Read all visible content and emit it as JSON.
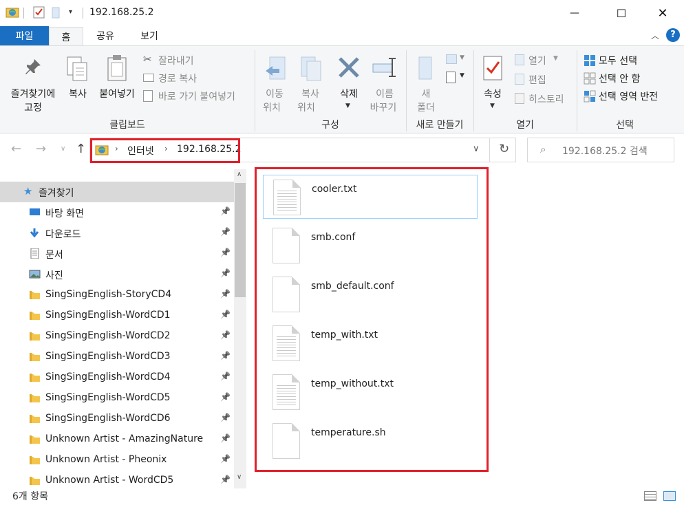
{
  "window": {
    "title": "192.168.25.2",
    "minimize_glyph": "—",
    "maximize_glyph": "☐",
    "close_glyph": "✕"
  },
  "tabs": [
    {
      "label": "파일",
      "active": false
    },
    {
      "label": "홈",
      "active": true
    },
    {
      "label": "공유",
      "active": false
    },
    {
      "label": "보기",
      "active": false
    }
  ],
  "ribbon": {
    "clipboard": {
      "pin_label_1": "즐겨찾기에",
      "pin_label_2": "고정",
      "copy_label": "복사",
      "paste_label": "붙여넣기",
      "cut_label": "잘라내기",
      "copy_path_label": "경로 복사",
      "paste_shortcut_label": "바로 가기 붙여넣기",
      "group_label": "클립보드"
    },
    "organize": {
      "move_label_1": "이동",
      "move_label_2": "위치",
      "copy_to_label_1": "복사",
      "copy_to_label_2": "위치",
      "delete_label": "삭제",
      "rename_label_1": "이름",
      "rename_label_2": "바꾸기",
      "group_label": "구성"
    },
    "new": {
      "new_folder_label_1": "새",
      "new_folder_label_2": "폴더",
      "group_label": "새로 만들기"
    },
    "open": {
      "properties_label": "속성",
      "open_label": "열기",
      "edit_label": "편집",
      "history_label": "히스토리",
      "group_label": "열기"
    },
    "select": {
      "select_all_label": "모두 선택",
      "select_none_label": "선택 안 함",
      "invert_label": "선택 영역 반전",
      "group_label": "선택"
    }
  },
  "address": {
    "crumbs": [
      "인터넷",
      "192.168.25.2"
    ],
    "search_placeholder": "192.168.25.2 검색"
  },
  "nav": {
    "favorites_label": "즐겨찾기",
    "items": [
      {
        "label": "바탕 화면",
        "icon": "desktop-icon"
      },
      {
        "label": "다운로드",
        "icon": "download-icon"
      },
      {
        "label": "문서",
        "icon": "documents-icon"
      },
      {
        "label": "사진",
        "icon": "pictures-icon"
      },
      {
        "label": "SingSingEnglish-StoryCD4",
        "icon": "folder-icon"
      },
      {
        "label": "SingSingEnglish-WordCD1",
        "icon": "folder-icon"
      },
      {
        "label": "SingSingEnglish-WordCD2",
        "icon": "folder-icon"
      },
      {
        "label": "SingSingEnglish-WordCD3",
        "icon": "folder-icon"
      },
      {
        "label": "SingSingEnglish-WordCD4",
        "icon": "folder-icon"
      },
      {
        "label": "SingSingEnglish-WordCD5",
        "icon": "folder-icon"
      },
      {
        "label": "SingSingEnglish-WordCD6",
        "icon": "folder-icon"
      },
      {
        "label": "Unknown Artist - AmazingNature",
        "icon": "folder-icon"
      },
      {
        "label": "Unknown Artist - Pheonix",
        "icon": "folder-icon"
      },
      {
        "label": "Unknown Artist - WordCD5",
        "icon": "folder-icon"
      }
    ]
  },
  "files": [
    {
      "name": "cooler.txt",
      "lined": true
    },
    {
      "name": "smb.conf",
      "lined": false
    },
    {
      "name": "smb_default.conf",
      "lined": false
    },
    {
      "name": "temp_with.txt",
      "lined": true
    },
    {
      "name": "temp_without.txt",
      "lined": true
    },
    {
      "name": "temperature.sh",
      "lined": false
    }
  ],
  "status": {
    "count": "6개 항목"
  },
  "colors": {
    "accent": "#1a6fc2",
    "highlight": "#e0202b",
    "selection_border": "#99d1ff"
  }
}
